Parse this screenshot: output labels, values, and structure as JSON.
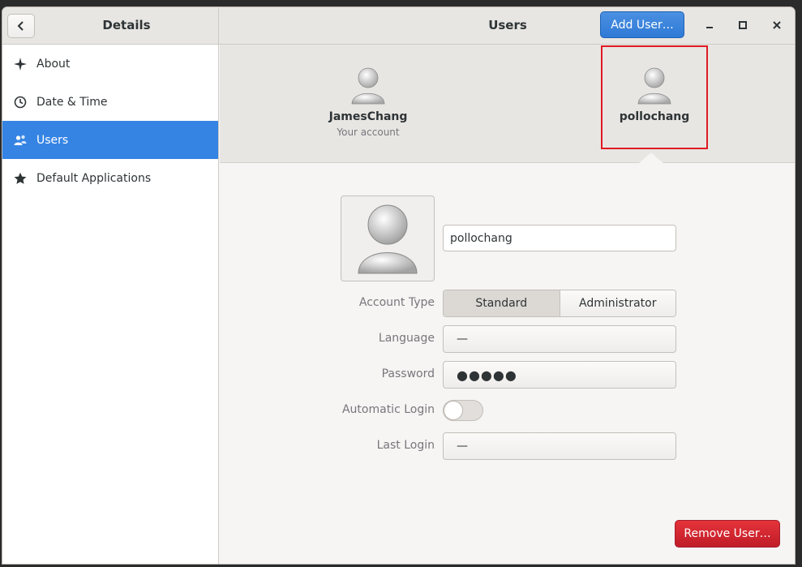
{
  "window": {
    "title": "Users",
    "sidebar_title": "Details",
    "add_user_label": "Add User…"
  },
  "sidebar": {
    "items": [
      {
        "label": "About",
        "icon": "sparkle-icon"
      },
      {
        "label": "Date & Time",
        "icon": "clock-icon"
      },
      {
        "label": "Users",
        "icon": "users-icon",
        "active": true
      },
      {
        "label": "Default Applications",
        "icon": "star-icon"
      }
    ]
  },
  "users": [
    {
      "name": "JamesChang",
      "subtitle": "Your account"
    },
    {
      "name": "pollochang",
      "selected": true
    }
  ],
  "detail": {
    "username": "pollochang",
    "account_type_label": "Account Type",
    "account_type_options": [
      "Standard",
      "Administrator"
    ],
    "account_type_selected": "Standard",
    "language_label": "Language",
    "language_value": "—",
    "password_label": "Password",
    "password_value": "●●●●●",
    "autologin_label": "Automatic Login",
    "autologin_on": false,
    "lastlogin_label": "Last Login",
    "lastlogin_value": "—",
    "remove_label": "Remove User…"
  },
  "colors": {
    "accent": "#3584e4",
    "destructive": "#c01c28",
    "selection_outline": "#e01b24"
  }
}
